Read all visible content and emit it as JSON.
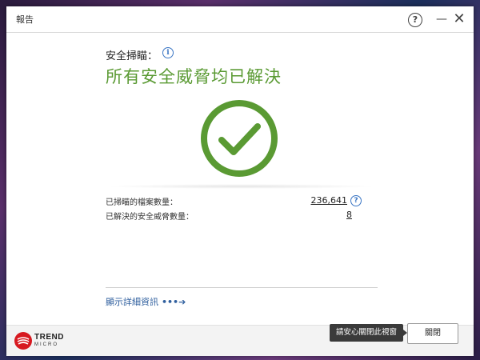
{
  "window": {
    "title": "報告",
    "help_label": "?",
    "minimize_label": "—",
    "close_label": "✕"
  },
  "scan": {
    "label": "安全掃瞄：",
    "info_label": "i",
    "headline": "所有安全威脅均已解決",
    "status": "success"
  },
  "stats": [
    {
      "label": "已掃瞄的檔案數量：",
      "value": "236,641",
      "help": "?"
    },
    {
      "label": "已解決的安全威脅數量：",
      "value": "8"
    }
  ],
  "details_link": {
    "label": "顯示詳細資訊",
    "arrow": "•••➔"
  },
  "footer": {
    "logo_line1": "TREND",
    "logo_line2": "MICRO",
    "tooltip": "請安心關閉此視窗",
    "close_button": "關閉"
  },
  "colors": {
    "success_green": "#5a9a33",
    "link_blue": "#2f5f9e",
    "brand_red": "#d71920"
  }
}
